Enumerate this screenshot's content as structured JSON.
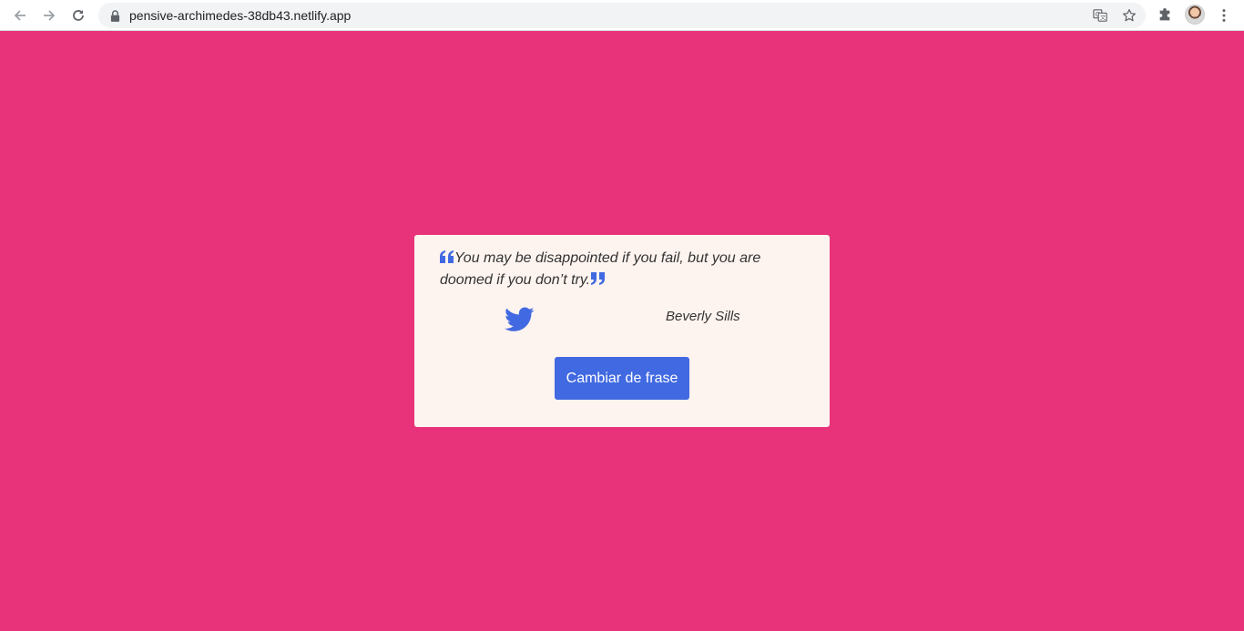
{
  "browser": {
    "url": "pensive-archimedes-38db43.netlify.app",
    "icons": {
      "back": "arrow-left-icon",
      "forward": "arrow-right-icon",
      "reload": "reload-icon",
      "lock": "lock-icon",
      "translate": "translate-icon",
      "bookmark": "star-icon",
      "extensions": "puzzle-icon",
      "menu": "more-vert-icon"
    }
  },
  "page": {
    "background_color": "#e8337a",
    "card_color": "#fdf3ef",
    "accent_color": "#4169e1"
  },
  "quote": {
    "text": "You may be disappointed if you fail, but you are doomed if you don’t try.",
    "author": "Beverly Sills"
  },
  "actions": {
    "new_quote_label": "Cambiar de frase",
    "tweet_icon": "twitter-icon"
  }
}
